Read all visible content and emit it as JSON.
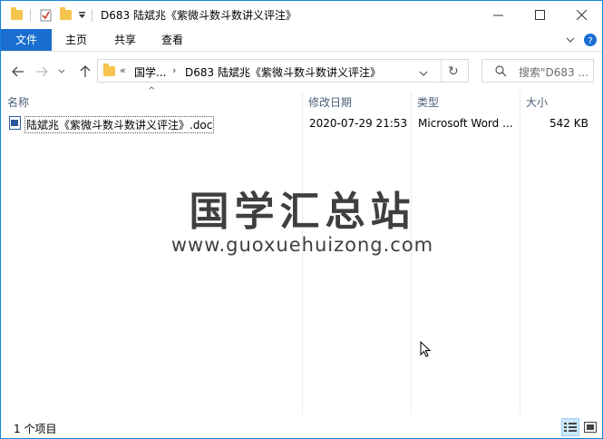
{
  "window": {
    "title": "D683 陆斌兆《紫微斗数斗数讲义评注》",
    "controls": {
      "minimize": "—",
      "maximize": "☐",
      "close": "✕"
    }
  },
  "ribbon": {
    "tabs": [
      "文件",
      "主页",
      "共享",
      "查看"
    ],
    "expand_icon": "chevron-down",
    "help_icon": "question"
  },
  "nav": {
    "back": "←",
    "forward": "→",
    "recent": "⌄",
    "up": "↑"
  },
  "address": {
    "overflow": "«",
    "crumbs": [
      "国学...",
      "D683 陆斌兆《紫微斗数斗数讲义评注》"
    ],
    "refresh": "↻"
  },
  "search": {
    "placeholder": "搜索\"D683 ..."
  },
  "columns": {
    "name": "名称",
    "modified": "修改日期",
    "type": "类型",
    "size": "大小",
    "sort_indicator": "^"
  },
  "files": [
    {
      "name": "陆斌兆《紫微斗数斗数讲义评注》.doc",
      "modified": "2020-07-29 21:53",
      "type": "Microsoft Word ...",
      "size": "542 KB",
      "icon": "word-doc-icon"
    }
  ],
  "watermark": {
    "title": "国学汇总站",
    "url": "www.guoxuehuizong.com"
  },
  "status": {
    "count": "1 个项目"
  },
  "colors": {
    "accent": "#1a6ed0",
    "border": "#1883d7",
    "header_text": "#4c607a"
  }
}
